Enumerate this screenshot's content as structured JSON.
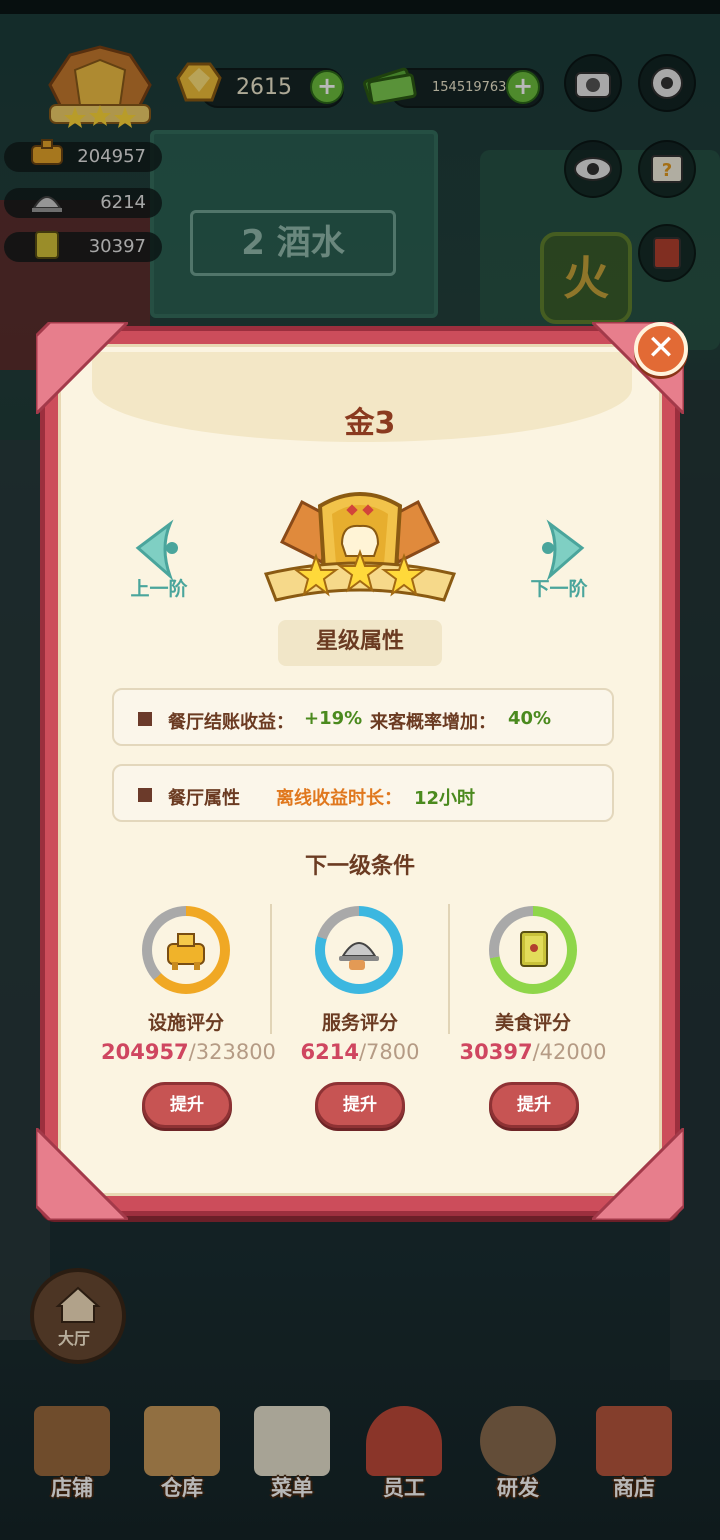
{
  "hud": {
    "gold": "2615",
    "cash": "154519763",
    "facility_score": "204957",
    "service_score": "6214",
    "food_score": "30397"
  },
  "scene": {
    "sign_text": "酒水",
    "sign_number": "2",
    "fire_text": "火"
  },
  "dialog": {
    "title": "金3",
    "prev_label": "上一阶",
    "next_label": "下一阶",
    "attr_header": "星级属性",
    "attr_row1": {
      "k1": "餐厅结账收益：",
      "v1": "+19%",
      "k2": "来客概率增加：",
      "v2": "40%"
    },
    "attr_row2": {
      "label": "餐厅属性",
      "k": "离线收益时长：",
      "v": "12小时"
    },
    "next_header": "下一级条件",
    "categories": [
      {
        "label": "设施评分",
        "current": "204957",
        "target": "323800",
        "button": "提升",
        "progress": 0.63,
        "color": "#f0a824"
      },
      {
        "label": "服务评分",
        "current": "6214",
        "target": "7800",
        "button": "提升",
        "progress": 0.8,
        "color": "#3cb7e0"
      },
      {
        "label": "美食评分",
        "current": "30397",
        "target": "42000",
        "button": "提升",
        "progress": 0.72,
        "color": "#8fd64a"
      }
    ]
  },
  "bottom": {
    "hall": "大厅",
    "nav": [
      "店铺",
      "仓库",
      "菜单",
      "员工",
      "研发",
      "商店"
    ]
  }
}
